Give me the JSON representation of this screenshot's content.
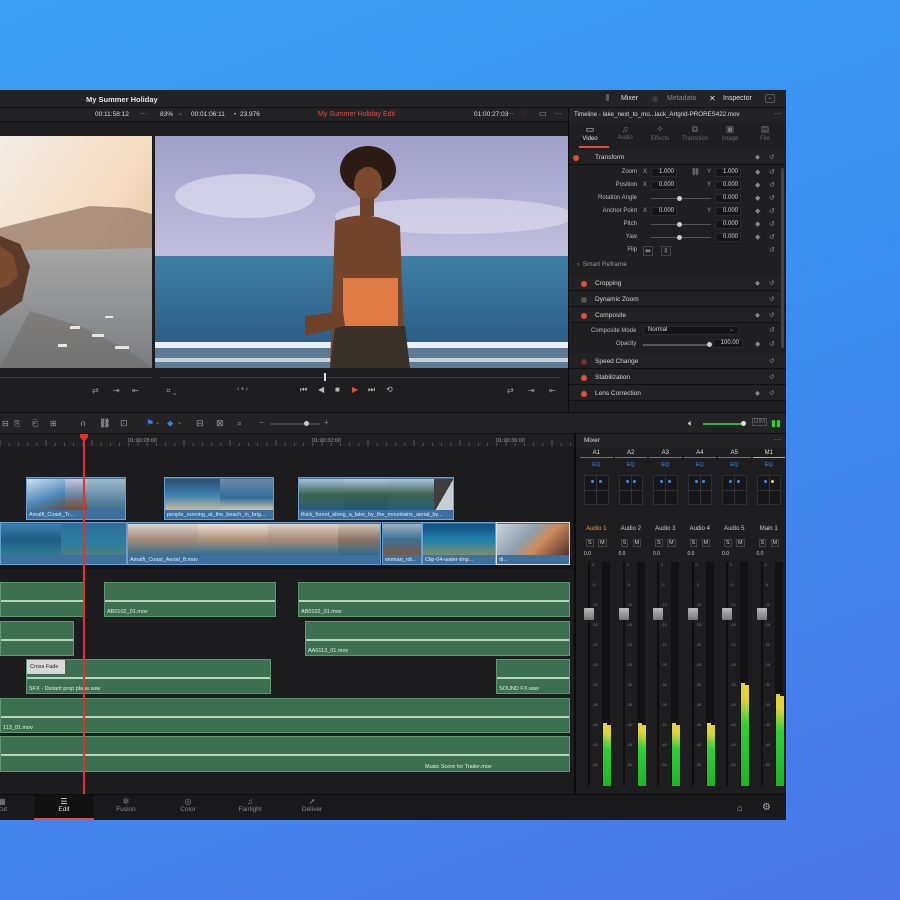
{
  "header": {
    "title": "My Summer Holiday",
    "mixer": "Mixer",
    "metadata": "Metadata",
    "inspector": "Inspector"
  },
  "viewer": {
    "src_timecode": "00:11:58:12",
    "zoom": "83%",
    "duration": "00:01:06:11",
    "fps": "23.976",
    "timeline_name": "My Summer Holiday Edit",
    "rec_timecode": "01:00:27:03",
    "clip_title": "Timeline - lake_next_to_mo...lack_Artgrid-PRORES422.mov"
  },
  "inspector": {
    "tabs": [
      {
        "label": "Video",
        "icon": "video-icon"
      },
      {
        "label": "Audio",
        "icon": "audio-icon"
      },
      {
        "label": "Effects",
        "icon": "effects-icon"
      },
      {
        "label": "Transition",
        "icon": "transition-icon"
      },
      {
        "label": "Image",
        "icon": "image-icon"
      },
      {
        "label": "File",
        "icon": "file-icon"
      }
    ],
    "transform": {
      "title": "Transform",
      "zoom": "Zoom",
      "zoom_x": "1.000",
      "zoom_y": "1.000",
      "position": "Position",
      "pos_x": "0.000",
      "pos_y": "0.000",
      "rotation": "Rotation Angle",
      "rotation_val": "0.000",
      "anchor": "Anchor Point",
      "anchor_x": "0.000",
      "anchor_y": "0.000",
      "pitch": "Pitch",
      "pitch_val": "0.000",
      "yaw": "Yaw",
      "yaw_val": "0.000",
      "flip": "Flip",
      "x": "X",
      "y": "Y"
    },
    "smart_reframe": "Smart Reframe",
    "cropping": "Cropping",
    "dynamic_zoom": "Dynamic Zoom",
    "composite": {
      "title": "Composite",
      "mode_label": "Composite Mode",
      "mode": "Normal",
      "opacity_label": "Opacity",
      "opacity": "100.00"
    },
    "speed": "Speed Change",
    "stabilization": "Stabilization",
    "lens": "Lens Correction"
  },
  "timeline": {
    "ruler": [
      "01:00:28:00",
      "01:00:32:00",
      "01:00:36:00"
    ],
    "video_clips_v2": [
      "Amalfi_Coast_Tr...",
      "people_running_at_the_beach_in_brig...",
      "thick_forest_along_a_lake_by_the_mountains_aerial_by..."
    ],
    "video_clips_v1": [
      "Amalfi_Coast_Aerial_8.mov",
      "woman_rdi...",
      "Clip-04-water-tmp...",
      "di..."
    ],
    "audio_clips": {
      "a1a": "AB0102_01.mov",
      "a1b": "AB0102_01.mov",
      "a2": "AA0113_01.mov",
      "a3_fade": "Cross Fade",
      "a3": "SFX - Distant prop plane.wav",
      "a3b": "SOUND FX.wav",
      "a4": "113_01.mov",
      "a5": "Music Score for Trailer.mov"
    }
  },
  "mixer": {
    "title": "Mixer",
    "channels": [
      {
        "id": "A1",
        "name": "Audio 1",
        "level": 0.28
      },
      {
        "id": "A2",
        "name": "Audio 2",
        "level": 0.28
      },
      {
        "id": "A3",
        "name": "Audio 3",
        "level": 0.28
      },
      {
        "id": "A4",
        "name": "Audio 4",
        "level": 0.28
      },
      {
        "id": "A5",
        "name": "Audio 5",
        "level": 0.46
      },
      {
        "id": "M1",
        "name": "Main 1",
        "level": 0.41
      }
    ],
    "eq": "EQ",
    "solo": "S",
    "mute": "M",
    "db": "0.0",
    "scale": [
      "0",
      "-5",
      "-10",
      "-15",
      "-20",
      "-25",
      "-30",
      "-35",
      "-40",
      "-45",
      "-50"
    ]
  },
  "pages": [
    {
      "label": "Cut",
      "icon": "cut-icon"
    },
    {
      "label": "Edit",
      "icon": "edit-icon"
    },
    {
      "label": "Fusion",
      "icon": "fusion-icon"
    },
    {
      "label": "Color",
      "icon": "color-icon"
    },
    {
      "label": "Fairlight",
      "icon": "fairlight-icon"
    },
    {
      "label": "Deliver",
      "icon": "deliver-icon"
    }
  ],
  "colors": {
    "accent": "#e64b3b",
    "video_clip": "#3d6f9f",
    "audio_clip": "#3c7050",
    "playhead": "#e0332b"
  }
}
